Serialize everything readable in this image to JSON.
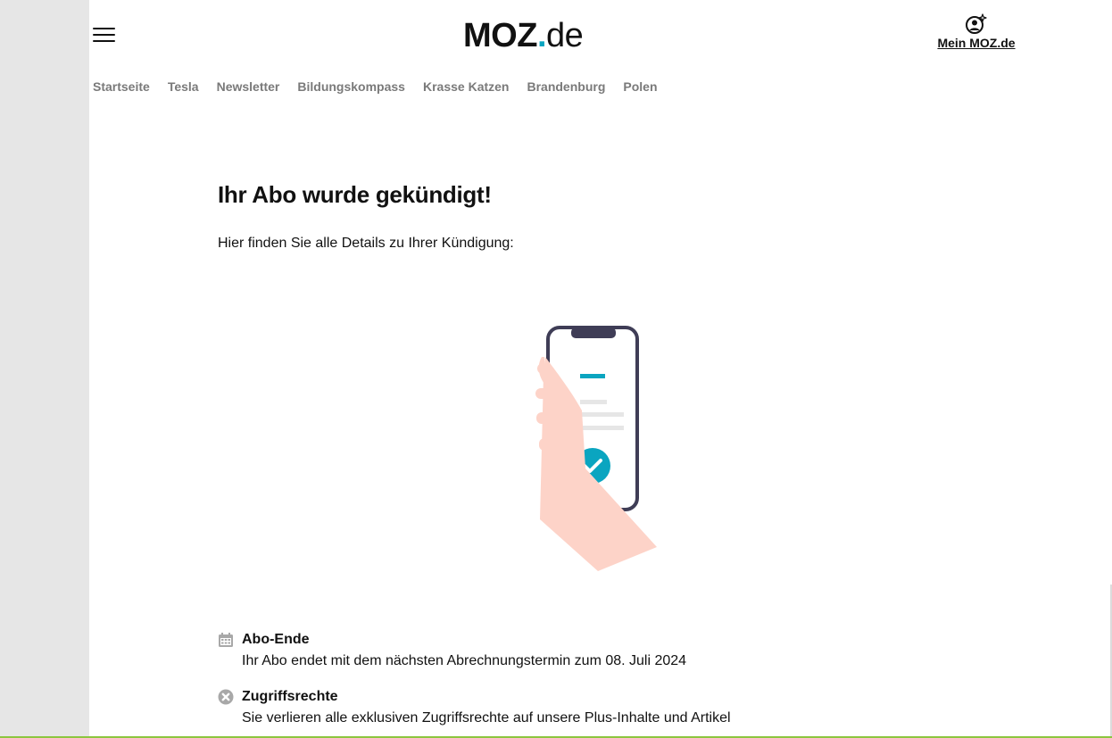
{
  "header": {
    "logo": {
      "main": "MOZ",
      "dot": ".",
      "tld": "de"
    },
    "account_label": "Mein MOZ.de",
    "icons": {
      "menu": "hamburger-menu-icon",
      "account": "user-sparkle-icon"
    }
  },
  "nav": {
    "items": [
      {
        "label": "Startseite"
      },
      {
        "label": "Tesla"
      },
      {
        "label": "Newsletter"
      },
      {
        "label": "Bildungskompass"
      },
      {
        "label": "Krasse Katzen"
      },
      {
        "label": "Brandenburg"
      },
      {
        "label": "Polen"
      }
    ]
  },
  "main": {
    "headline": "Ihr Abo wurde gekündigt!",
    "intro": "Hier finden Sie alle Details zu Ihrer Kündigung:",
    "illustration": "hand-holding-phone-with-checkmark",
    "details": [
      {
        "icon": "calendar-icon",
        "title": "Abo-Ende",
        "text": "Ihr Abo endet mit dem nächsten Abrechnungstermin zum 08. Juli 2024"
      },
      {
        "icon": "close-circle-icon",
        "title": "Zugriffsrechte",
        "text": "Sie verlieren alle exklusiven Zugriffsrechte auf unsere Plus-Inhalte und Artikel"
      }
    ]
  },
  "colors": {
    "accent": "#0aa5c0",
    "nav_text": "#7a7a7a",
    "hand": "#fdd3c8",
    "phone_frame": "#3f3d56",
    "icon_gray": "#a8a8a8"
  }
}
